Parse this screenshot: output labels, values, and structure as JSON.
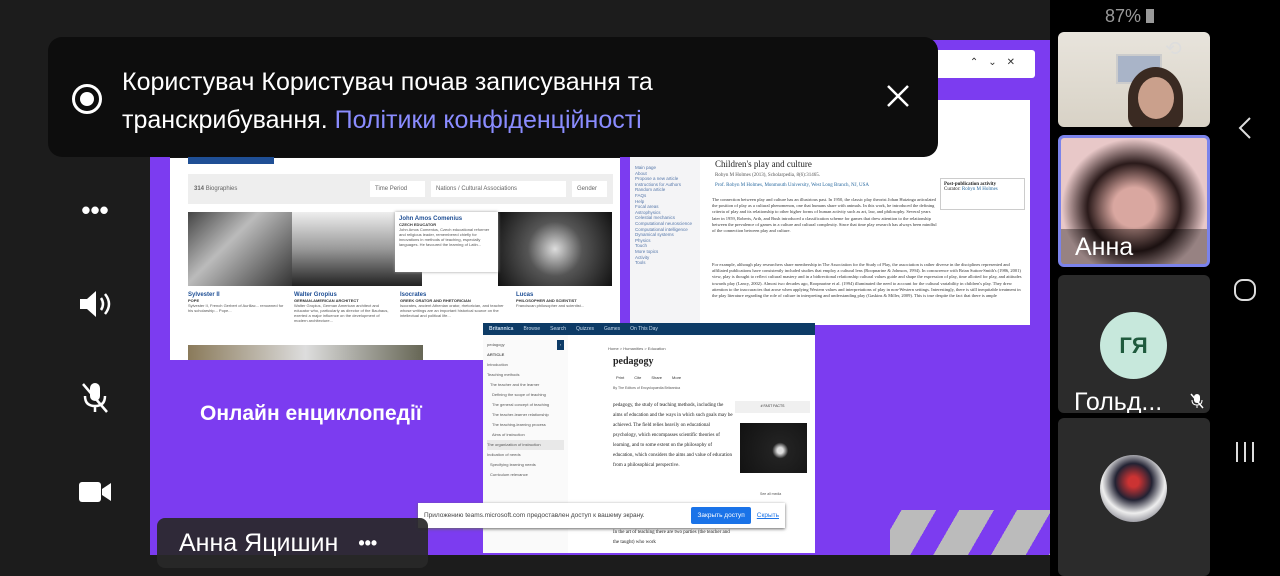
{
  "status_bar": {
    "battery": "87%"
  },
  "banner": {
    "message": "Користувач Користувач почав записування та транскрибування.",
    "link": "Політики конфіденційності"
  },
  "presenter": {
    "name": "Анна Яцишин",
    "more": "•••"
  },
  "slide": {
    "title": "Онлайн енциклопедії",
    "biographies": {
      "count": "314",
      "count_label": "Biographies",
      "filters": [
        "Time Period",
        "Nations / Cultural Associations",
        "Gender"
      ],
      "people": [
        {
          "name": "Sylvester II",
          "role": "POPE",
          "text": "Sylvester II, French Gerbert of Aurillac... renowned for his scholarship... Pope..."
        },
        {
          "name": "Walter Gropius",
          "role": "GERMAN-AMERICAN ARCHITECT",
          "text": "Walter Gropius, German American architect and educator who, particularly as director of the Bauhaus, exerted a major influence on the development of modern architecture..."
        },
        {
          "name": "Isocrates",
          "role": "GREEK ORATOR AND RHETORICIAN",
          "text": "Isocrates, ancient Athenian orator, rhetorician, and teacher whose writings are an important historical source on the intellectual and political life..."
        },
        {
          "name": "Lucas",
          "role": "PHILOSOPHER AND SCIENTIST",
          "text": "Franciscan philosopher and scientist..."
        }
      ],
      "popup": {
        "name": "John Amos Comenius",
        "role": "CZECH EDUCATOR",
        "text": "John Amos Comenius, Czech educational reformer and religious leader, remembered chiefly for innovations in methods of teaching, especially languages. He favoured the learning of Latin..."
      }
    },
    "article": {
      "title": "Children's play and culture",
      "citation": "Robyn M Holmes (2013), Scholarpedia, 8(6):31465.",
      "author": "Prof. Robyn M Holmes, Monmouth University, West Long Branch, NJ, USA",
      "side_title": "Post-publication activity",
      "curator_label": "Curator:",
      "curator": "Robyn M Holmes",
      "nav": [
        "Main page",
        "About",
        "Propose a new article",
        "Instructions for Authors",
        "Random article",
        "FAQs",
        "Help",
        "Focal areas",
        "Astrophysics",
        "Celestial mechanics",
        "Computational neuroscience",
        "Computational intelligence",
        "Dynamical systems",
        "Physics",
        "Touch",
        "More topics",
        "Activity",
        "Tools"
      ],
      "para1": "The connection between play and culture has an illustrious past. In 1950, the classic play theorist Johan Huizinga articulated the position of play as a cultural phenomenon, one that humans share with animals. In this work, he introduced the defining criteria of play and its relationship to other higher forms of human activity such as art, law, and philosophy. Several years later in 1959, Roberts, Arth, and Bush introduced a classification scheme for games that drew attention to the relationship between the prevalence of games in a culture and cultural complexity. Since that time play research has always been mindful of the connection between play and culture.",
      "para2": "For example, although play researchers share membership in The Association for the Study of Play, the association is rather diverse in the disciplines represented and affiliated publications have consistently included studies that employ a cultural lens (Roopnarine & Johnson, 1994). In concurrence with Brian Sutton-Smith's (1986, 2001) view, play is thought to reflect cultural mastery and in a bidirectional relationship cultural values guide and shape the expression of play, time allotted for play, and attitudes towards play (Lancy, 2002). Almost two decades ago, Roopnarine et al. (1994) illuminated the need to account for the cultural variability in children's play. They drew attention to the inaccuracies that arose when applying Western values and interpretations of play in non-Western settings. Interestingly, there is still inequitable treatment in the play literature regarding the role of culture in interpreting and understanding play (Gaskins & Miller, 2009). This is true despite the fact that there is ample"
    },
    "britannica": {
      "brand": "Britannica",
      "menu": [
        "Browse",
        "Search",
        "Quizzes",
        "Games",
        "On This Day"
      ],
      "search_value": "pedagogy",
      "section": "ARTICLE",
      "toc": [
        "Introduction",
        "Teaching methods",
        "The teacher and the learner",
        "Defining the scope of teaching",
        "The general concept of teaching",
        "The teacher-learner relationship",
        "The teaching-learning process",
        "Aims of instruction",
        "The organization of instruction",
        "Indication of needs",
        "Specifying learning needs",
        "Curriculum relevance"
      ],
      "breadcrumb": "Home > Humanities > Education",
      "title": "pedagogy",
      "actions": [
        "Print",
        "Cite",
        "Share",
        "More"
      ],
      "byline": "By The Editors of Encyclopaedia Britannica",
      "body": "pedagogy, the study of teaching methods, including the aims of education and the ways in which such goals may be achieved. The field relies heavily on educational psychology, which encompasses scientific theories of learning, and to some extent on the philosophy of education, which considers the aims and value of education from a philosophical perspective.",
      "body2": "In the art of teaching there are two parties (the teacher and the taught) who work",
      "facts": "# FAST FACTS",
      "see_all": "See all media"
    },
    "share_bar": {
      "text": "Приложению teams.microsoft.com предоставлен доступ к вашему экрану.",
      "stop": "Закрыть доступ",
      "hide": "Скрыть"
    }
  },
  "participants": [
    {
      "name": "Анна Яц..."
    },
    {
      "initials": "ГЯ",
      "name": "Гольд..."
    }
  ],
  "colors": {
    "slide": "#7c3cf0",
    "link": "#8a8cff",
    "active_border": "#7b83eb",
    "avatar_bg": "#c7e8dc",
    "avatar_fg": "#1f5a3d"
  }
}
